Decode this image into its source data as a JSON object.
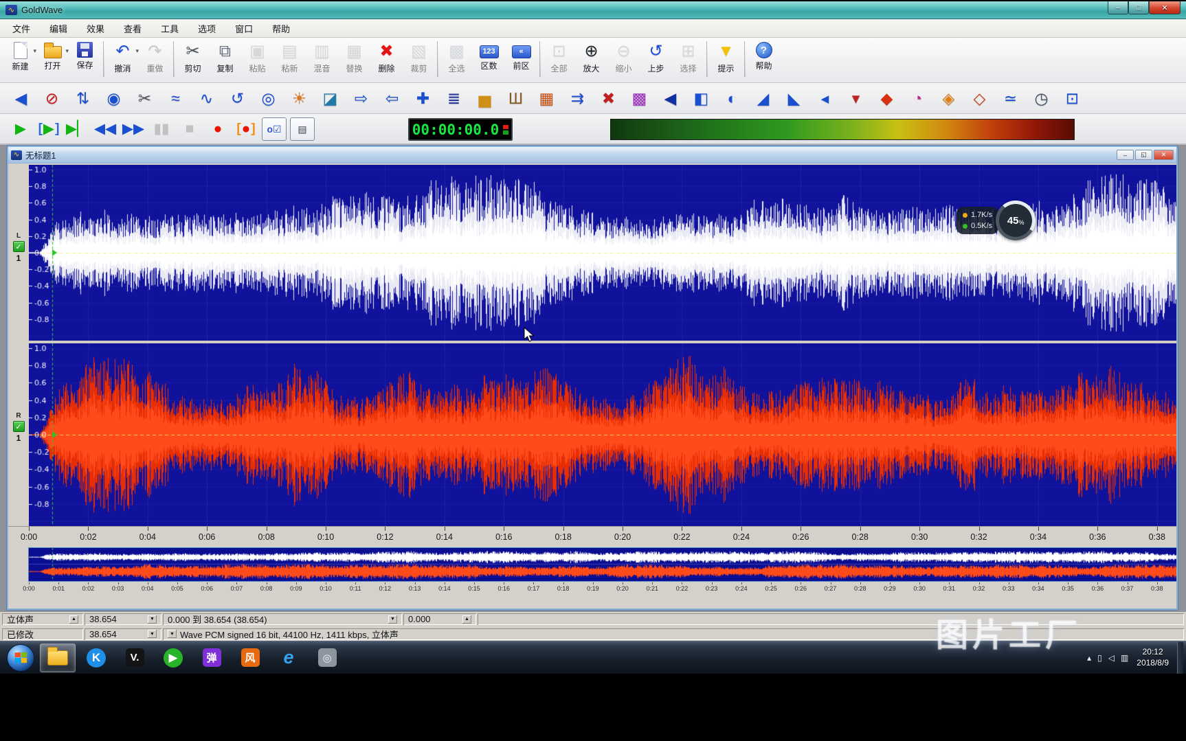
{
  "titlebar": {
    "title": "GoldWave",
    "minimize": "–",
    "maximize": "□",
    "close": "✕"
  },
  "menubar": {
    "items": [
      "文件",
      "编辑",
      "效果",
      "查看",
      "工具",
      "选项",
      "窗口",
      "帮助"
    ]
  },
  "toolbar_main": {
    "items": [
      {
        "name": "new",
        "label": "新建",
        "kind": "page",
        "enabled": true,
        "dropdown": true
      },
      {
        "name": "open",
        "label": "打开",
        "kind": "folder",
        "enabled": true,
        "dropdown": true
      },
      {
        "name": "save",
        "label": "保存",
        "kind": "floppy",
        "enabled": true
      },
      {
        "sep": true
      },
      {
        "name": "undo",
        "label": "撤消",
        "kind": "glyph",
        "glyph": "↶",
        "color": "#1a50d8",
        "enabled": true,
        "dropdown": true
      },
      {
        "name": "redo",
        "label": "重做",
        "kind": "glyph",
        "glyph": "↷",
        "color": "#9aa2ae",
        "enabled": false
      },
      {
        "sep": true
      },
      {
        "name": "cut",
        "label": "剪切",
        "kind": "glyph",
        "glyph": "✂",
        "color": "#4a5058",
        "enabled": true
      },
      {
        "name": "copy",
        "label": "复制",
        "kind": "glyph",
        "glyph": "⧉",
        "color": "#6a7280",
        "enabled": true
      },
      {
        "name": "paste",
        "label": "粘贴",
        "kind": "glyph",
        "glyph": "▣",
        "color": "#b9bec8",
        "enabled": false
      },
      {
        "name": "paste-new",
        "label": "粘新",
        "kind": "glyph",
        "glyph": "▤",
        "color": "#b9bec8",
        "enabled": false
      },
      {
        "name": "mix",
        "label": "混音",
        "kind": "glyph",
        "glyph": "▥",
        "color": "#b9bec8",
        "enabled": false
      },
      {
        "name": "replace",
        "label": "替换",
        "kind": "glyph",
        "glyph": "▦",
        "color": "#b9bec8",
        "enabled": false
      },
      {
        "name": "delete",
        "label": "删除",
        "kind": "glyph",
        "glyph": "✖",
        "color": "#e41414",
        "enabled": true
      },
      {
        "name": "trim",
        "label": "裁剪",
        "kind": "glyph",
        "glyph": "▧",
        "color": "#b9bec8",
        "enabled": false
      },
      {
        "sep": true
      },
      {
        "name": "select-all",
        "label": "全选",
        "kind": "glyph",
        "glyph": "▩",
        "color": "#b6c4e4",
        "enabled": false
      },
      {
        "name": "marker",
        "label": "区数",
        "kind": "box",
        "text": "123",
        "enabled": true
      },
      {
        "name": "prev-region",
        "label": "前区",
        "kind": "box",
        "text": "«",
        "enabled": true
      },
      {
        "sep": true
      },
      {
        "name": "zoom-all",
        "label": "全部",
        "kind": "glyph",
        "glyph": "⊡",
        "color": "#b9bec8",
        "enabled": false
      },
      {
        "name": "zoom-in",
        "label": "放大",
        "kind": "glyph",
        "glyph": "⊕",
        "color": "#20262e",
        "enabled": true
      },
      {
        "name": "zoom-out",
        "label": "缩小",
        "kind": "glyph",
        "glyph": "⊖",
        "color": "#b9bec8",
        "enabled": false
      },
      {
        "name": "zoom-prev",
        "label": "上步",
        "kind": "glyph",
        "glyph": "↺",
        "color": "#1a50d8",
        "enabled": true
      },
      {
        "name": "zoom-selection",
        "label": "选择",
        "kind": "glyph",
        "glyph": "⊞",
        "color": "#b9bec8",
        "enabled": false
      },
      {
        "sep": true
      },
      {
        "name": "tips",
        "label": "提示",
        "kind": "glyph",
        "glyph": "▼",
        "color": "#f2c200",
        "enabled": true
      },
      {
        "sep": true
      },
      {
        "name": "help",
        "label": "帮助",
        "kind": "help",
        "text": "?",
        "enabled": true
      }
    ]
  },
  "toolbar_effects": {
    "items": [
      {
        "name": "volume-shape",
        "glyph": "◀",
        "color": "#1a4fd0"
      },
      {
        "name": "mute",
        "glyph": "⊘",
        "color": "#d01818"
      },
      {
        "name": "channel-swap",
        "glyph": "⇅",
        "color": "#1a4fd0"
      },
      {
        "name": "doppler",
        "glyph": "◉",
        "color": "#1a4fd0"
      },
      {
        "name": "noise-gate",
        "glyph": "✂",
        "color": "#50565e"
      },
      {
        "name": "pitch-bend",
        "glyph": "≈",
        "color": "#1a4fd0"
      },
      {
        "name": "flanger",
        "glyph": "∿",
        "color": "#1a4fd0"
      },
      {
        "name": "reverse",
        "glyph": "↺",
        "color": "#1a4fd0"
      },
      {
        "name": "mechanize",
        "glyph": "◎",
        "color": "#1a4fd0"
      },
      {
        "name": "pinwheel",
        "glyph": "☀",
        "color": "#e07818"
      },
      {
        "name": "spectrum",
        "glyph": "◪",
        "color": "#1f7aa8"
      },
      {
        "name": "offset-right",
        "glyph": "⇨",
        "color": "#1a4fd0"
      },
      {
        "name": "offset-left",
        "glyph": "⇦",
        "color": "#1a4fd0"
      },
      {
        "name": "expander",
        "glyph": "✚",
        "color": "#1a4fd0"
      },
      {
        "name": "equalizer",
        "glyph": "≣",
        "color": "#20309a"
      },
      {
        "name": "volume-bars",
        "glyph": "▅",
        "color": "#d09018"
      },
      {
        "name": "comb-filter",
        "glyph": "Ш",
        "color": "#8a5a20"
      },
      {
        "name": "mixer",
        "glyph": "▦",
        "color": "#d05818"
      },
      {
        "name": "exchange",
        "glyph": "⇉",
        "color": "#1a4fd0"
      },
      {
        "name": "noise-reduction",
        "glyph": "✖",
        "color": "#c02020"
      },
      {
        "name": "color-mixer",
        "glyph": "▩",
        "color": "#a030c0"
      },
      {
        "name": "cue-marker",
        "glyph": "◀",
        "color": "#102fa0"
      },
      {
        "name": "playback-device",
        "glyph": "◧",
        "color": "#1a4fd0"
      },
      {
        "name": "speaker-out",
        "glyph": "◐",
        "color": "#1a4fd0"
      },
      {
        "name": "fade-in",
        "glyph": "◢",
        "color": "#1a4fd0"
      },
      {
        "name": "fade-out",
        "glyph": "◣",
        "color": "#1a4fd0"
      },
      {
        "name": "volume-match",
        "glyph": "◂",
        "color": "#1a4fd0"
      },
      {
        "name": "volume-down",
        "glyph": "▾",
        "color": "#c02020"
      },
      {
        "name": "shape",
        "glyph": "◆",
        "color": "#d83010"
      },
      {
        "name": "preview",
        "glyph": "◔",
        "color": "#c02890"
      },
      {
        "name": "marker-orange",
        "glyph": "◈",
        "color": "#e08010"
      },
      {
        "name": "marker-double",
        "glyph": "◇",
        "color": "#d04010"
      },
      {
        "name": "smoother",
        "glyph": "≃",
        "color": "#1a4fd0"
      },
      {
        "name": "timer",
        "glyph": "◷",
        "color": "#405060"
      },
      {
        "name": "monitor-out",
        "glyph": "⊡",
        "color": "#1a4fd0"
      }
    ]
  },
  "transport": {
    "time": "00:00:00.0",
    "buttons": [
      {
        "name": "play",
        "glyph": "▶",
        "color": "#12b412",
        "enabled": true
      },
      {
        "name": "play-selection",
        "glyph": "▶",
        "color": "#12b412",
        "enabled": true,
        "bracket": "#2a6ae0"
      },
      {
        "name": "play-all",
        "glyph": "▶▏",
        "color": "#12b412",
        "enabled": true
      },
      {
        "name": "rewind",
        "glyph": "◀◀",
        "color": "#1a4fd0",
        "enabled": true
      },
      {
        "name": "fast-forward",
        "glyph": "▶▶",
        "color": "#1a4fd0",
        "enabled": true
      },
      {
        "name": "pause",
        "glyph": "▮▮",
        "color": "#8a8f98",
        "enabled": false
      },
      {
        "name": "stop",
        "glyph": "■",
        "color": "#8a8f98",
        "enabled": false
      },
      {
        "name": "record",
        "glyph": "●",
        "color": "#e81400",
        "enabled": true
      },
      {
        "name": "record-selection",
        "glyph": "●",
        "color": "#e81400",
        "enabled": true,
        "bracket": "#f09018"
      },
      {
        "name": "monitor-input",
        "glyph": "o☑",
        "color": "#2a55cc",
        "enabled": true,
        "boxed": true
      },
      {
        "name": "device-controls",
        "glyph": "▤",
        "color": "#333a44",
        "enabled": true,
        "boxed": true
      }
    ]
  },
  "doc": {
    "title": "无标题1",
    "btn_min": "–",
    "btn_restore": "◱",
    "btn_close": "✕"
  },
  "wave": {
    "duration_sec": 38.654,
    "check_glyph": "✓",
    "channels": [
      {
        "id": "L",
        "track": "1"
      },
      {
        "id": "R",
        "track": "1"
      }
    ],
    "amplitude_labels": [
      "1.0",
      "0.8",
      "0.6",
      "0.4",
      "0.2",
      "0.0",
      "-0.2",
      "-0.4",
      "-0.6",
      "-0.8"
    ],
    "time_labels": [
      "0:00",
      "0:02",
      "0:04",
      "0:06",
      "0:08",
      "0:10",
      "0:12",
      "0:14",
      "0:16",
      "0:18",
      "0:20",
      "0:22",
      "0:24",
      "0:26",
      "0:28",
      "0:30",
      "0:32",
      "0:34",
      "0:36",
      "0:38"
    ],
    "overview_labels": [
      "0:00",
      "0:01",
      "0:02",
      "0:03",
      "0:04",
      "0:05",
      "0:06",
      "0:07",
      "0:08",
      "0:09",
      "0:10",
      "0:11",
      "0:12",
      "0:13",
      "0:14",
      "0:15",
      "0:16",
      "0:17",
      "0:18",
      "0:19",
      "0:20",
      "0:21",
      "0:22",
      "0:23",
      "0:24",
      "0:25",
      "0:26",
      "0:27",
      "0:28",
      "0:29",
      "0:30",
      "0:31",
      "0:32",
      "0:33",
      "0:34",
      "0:35",
      "0:36",
      "0:37",
      "0:38"
    ],
    "colors": {
      "bg": "#10129b",
      "grid": "#4553cf",
      "left": "#ffffff",
      "right": "#ff4a1a",
      "center": "#eef060"
    }
  },
  "speed_overlay": {
    "up_rate": "1.7K/s",
    "down_rate": "0.5K/s",
    "percent": "45",
    "unit": "%"
  },
  "statusbar": {
    "mode": "立体声",
    "length": "38.654",
    "selection": "0.000 到 38.654 (38.654)",
    "position": "0.000",
    "state": "已修改",
    "length2": "38.654",
    "format": "Wave PCM signed 16 bit, 44100 Hz, 1411 kbps, 立体声",
    "spin_up": "▲",
    "spin_down": "▼"
  },
  "taskbar": {
    "clock_time": "20:12",
    "clock_date": "2018/8/9",
    "apps": [
      {
        "name": "explorer",
        "kind": "folder",
        "active": true
      },
      {
        "name": "kugou",
        "kind": "circle",
        "bg": "#1f8fe8",
        "fg": "#ffffff",
        "glyph": "K"
      },
      {
        "name": "player-v",
        "kind": "square",
        "bg": "#141414",
        "fg": "#ffffff",
        "glyph": "V."
      },
      {
        "name": "pptv",
        "kind": "circle",
        "bg": "#28b428",
        "fg": "#ffffff",
        "glyph": "▶"
      },
      {
        "name": "danmaku",
        "kind": "square",
        "bg": "#8030d8",
        "fg": "#ffffff",
        "glyph": "弹"
      },
      {
        "name": "storm-player",
        "kind": "square",
        "bg": "#e86a10",
        "fg": "#ffffff",
        "glyph": "风"
      },
      {
        "name": "ie-browser",
        "kind": "plain",
        "fg": "#35a0f0",
        "glyph": "e"
      },
      {
        "name": "camera-tool",
        "kind": "square",
        "bg": "#8d969e",
        "fg": "#eef2f6",
        "glyph": "◎"
      }
    ],
    "tray": [
      {
        "name": "tray-expand",
        "glyph": "▴"
      },
      {
        "name": "tray-battery",
        "glyph": "▯"
      },
      {
        "name": "tray-volume",
        "glyph": "◁"
      },
      {
        "name": "tray-network",
        "glyph": "▥"
      }
    ]
  },
  "watermark": "图片工厂"
}
